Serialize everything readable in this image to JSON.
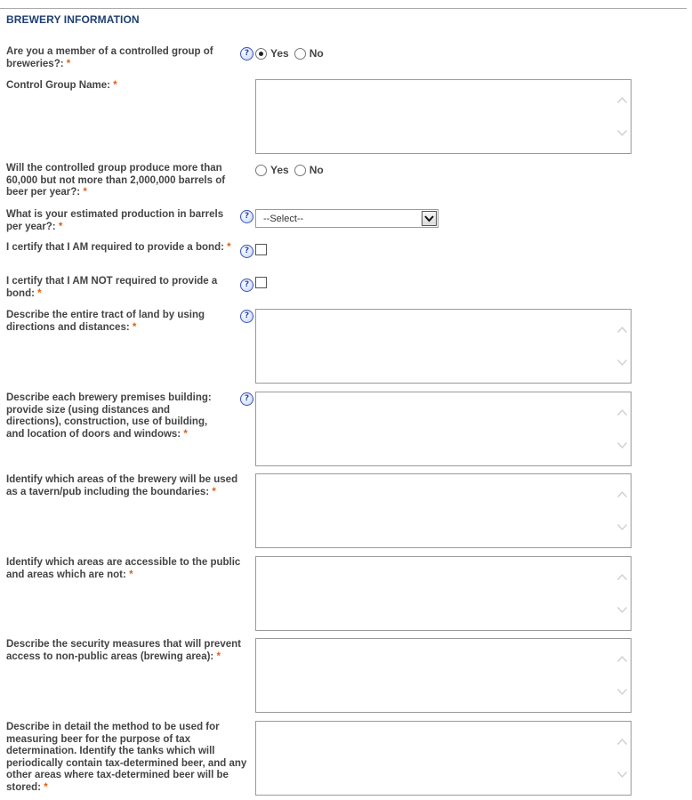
{
  "section": {
    "title": "BREWERY INFORMATION"
  },
  "required_marker": "*",
  "help_glyph": "?",
  "fields": {
    "controlled_group": {
      "label": "Are you a member of a controlled group of breweries?:",
      "options": [
        "Yes",
        "No"
      ],
      "selected": "Yes"
    },
    "control_group_name": {
      "label": "Control Group Name:",
      "value": ""
    },
    "controlled_group_production": {
      "label": "Will the controlled group produce more than 60,000 but not more than 2,000,000 barrels of beer per year?:",
      "options": [
        "Yes",
        "No"
      ],
      "selected": ""
    },
    "estimated_production": {
      "label": "What is your estimated production in barrels per year?:",
      "selected": "--Select--"
    },
    "bond_required": {
      "label": "I certify that I AM required to provide a bond:",
      "checked": false
    },
    "bond_not_required": {
      "label": "I certify that I AM NOT required to provide a bond:",
      "checked": false
    },
    "tract_of_land": {
      "label": "Describe the entire tract of land by using directions and distances:",
      "value": ""
    },
    "premises_building": {
      "label": "Describe each brewery premises building: provide size (using distances and directions), construction, use of building, and location of doors and windows:",
      "value": ""
    },
    "tavern_areas": {
      "label": "Identify which areas of the brewery will be used as a tavern/pub including the boundaries:",
      "value": ""
    },
    "public_areas": {
      "label": "Identify which areas are accessible to the public and areas which are not:",
      "value": ""
    },
    "security_measures": {
      "label": "Describe the security measures that will prevent access to non-public areas (brewing area):",
      "value": ""
    },
    "measuring_method": {
      "label": "Describe in detail the method to be used for measuring beer for the purpose of tax determination. Identify the tanks which will periodically contain tax-determined beer, and any other areas where tax-determined beer will be stored:",
      "value": ""
    }
  },
  "colors": {
    "section_title": "#1f3f73",
    "required": "#e0601b",
    "label": "#444444",
    "help_icon": "#2f49a8"
  }
}
